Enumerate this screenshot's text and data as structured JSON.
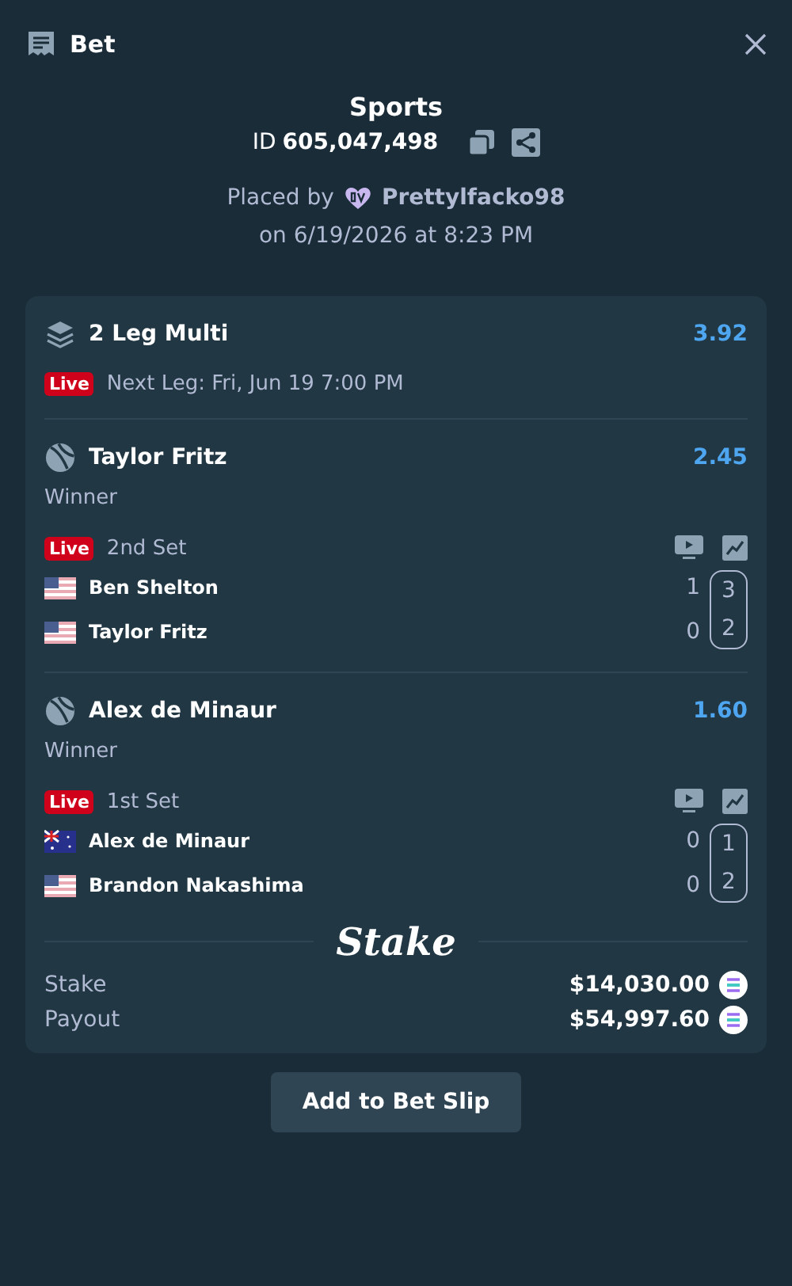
{
  "header": {
    "title": "Bet"
  },
  "summary": {
    "category": "Sports",
    "id_label": "ID",
    "id_value": "605,047,498",
    "placed_by_label": "Placed by",
    "user": "Prettylfacko98",
    "placed_on": "on 6/19/2026 at 8:23 PM"
  },
  "multi": {
    "title": "2 Leg Multi",
    "odds": "3.92",
    "live_badge": "Live",
    "next_leg": "Next Leg: Fri, Jun 19 7:00 PM"
  },
  "legs": [
    {
      "selection": "Taylor Fritz",
      "odds": "2.45",
      "market": "Winner",
      "live_badge": "Live",
      "period": "2nd Set",
      "players": [
        {
          "kind": "us",
          "name": "Ben Shelton",
          "games": "1",
          "sets": "3"
        },
        {
          "kind": "us",
          "name": "Taylor Fritz",
          "games": "0",
          "sets": "2"
        }
      ]
    },
    {
      "selection": "Alex de Minaur",
      "odds": "1.60",
      "market": "Winner",
      "live_badge": "Live",
      "period": "1st Set",
      "players": [
        {
          "kind": "au",
          "name": "Alex de Minaur",
          "games": "0",
          "sets": "1"
        },
        {
          "kind": "us",
          "name": "Brandon Nakashima",
          "games": "0",
          "sets": "2"
        }
      ]
    }
  ],
  "brand": "Stake",
  "totals": [
    {
      "label": "Stake",
      "amount": "$14,030.00"
    },
    {
      "label": "Payout",
      "amount": "$54,997.60"
    }
  ],
  "action_button": "Add to Bet Slip"
}
